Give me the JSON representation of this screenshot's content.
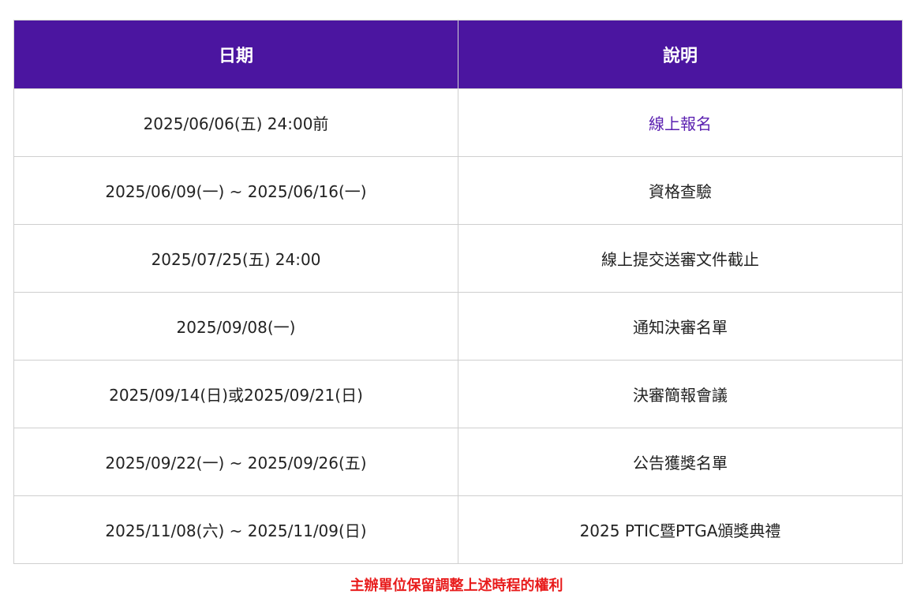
{
  "table": {
    "headers": [
      "日期",
      "說明"
    ],
    "rows": [
      {
        "date": "2025/06/06(五) 24:00前",
        "desc": "線上報名",
        "desc_is_link": true
      },
      {
        "date": "2025/06/09(一) ~ 2025/06/16(一)",
        "desc": "資格查驗",
        "desc_is_link": false
      },
      {
        "date": "2025/07/25(五) 24:00",
        "desc": "線上提交送審文件截止",
        "desc_is_link": false
      },
      {
        "date": "2025/09/08(一)",
        "desc": "通知決審名單",
        "desc_is_link": false
      },
      {
        "date": "2025/09/14(日)或2025/09/21(日)",
        "desc": "決審簡報會議",
        "desc_is_link": false
      },
      {
        "date": "2025/09/22(一) ~ 2025/09/26(五)",
        "desc": "公告獲獎名單",
        "desc_is_link": false
      },
      {
        "date": "2025/11/08(六) ~ 2025/11/09(日)",
        "desc": "2025 PTIC暨PTGA頒獎典禮",
        "desc_is_link": false
      }
    ]
  },
  "footnote": "主辦單位保留調整上述時程的權利",
  "colors": {
    "header_bg": "#4b15a0",
    "header_text": "#ffffff",
    "link": "#5a1fb0",
    "footnote": "#e81c1c",
    "border": "#cfcfcf"
  }
}
